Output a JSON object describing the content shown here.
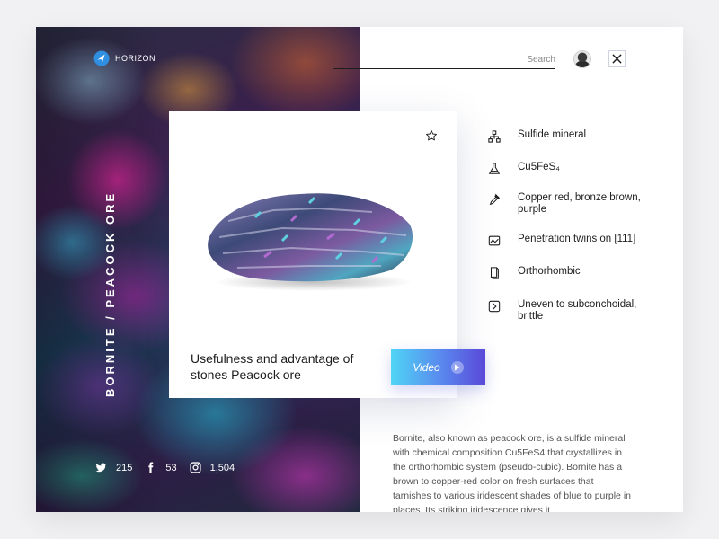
{
  "app": {
    "brand": "HORIZON"
  },
  "header": {
    "search_placeholder": "Search"
  },
  "mineral": {
    "vertical_title": "BORNITE / PEACOCK ORE",
    "card_title": "Usefulness and advantage of stones Peacock ore",
    "video_label": "Video"
  },
  "social": {
    "twitter_count": "215",
    "facebook_count": "53",
    "instagram_count": "1,504"
  },
  "properties": [
    {
      "icon": "hierarchy-icon",
      "text": "Sulfide mineral"
    },
    {
      "icon": "flask-icon",
      "text": "Cu5FeS₄"
    },
    {
      "icon": "eyedropper-icon",
      "text": "Copper red, bronze brown, purple"
    },
    {
      "icon": "crystal-twin-icon",
      "text": "Penetration twins on [111]"
    },
    {
      "icon": "crystal-icon",
      "text": "Orthorhombic"
    },
    {
      "icon": "fracture-icon",
      "text": "Uneven to subconchoidal, brittle"
    }
  ],
  "description": "Bornite, also known as peacock ore, is a sulfide mineral with chemical composition Cu5FeS4 that crystallizes in the orthorhombic system (pseudo-cubic). Bornite has a brown to copper-red color on fresh surfaces that tarnishes to various iridescent shades of blue to purple in places. Its striking iridescence gives it",
  "colors": {
    "accent_gradient_start": "#4fd5f5",
    "accent_gradient_end": "#5a49d8",
    "text": "#1d1d1f"
  }
}
